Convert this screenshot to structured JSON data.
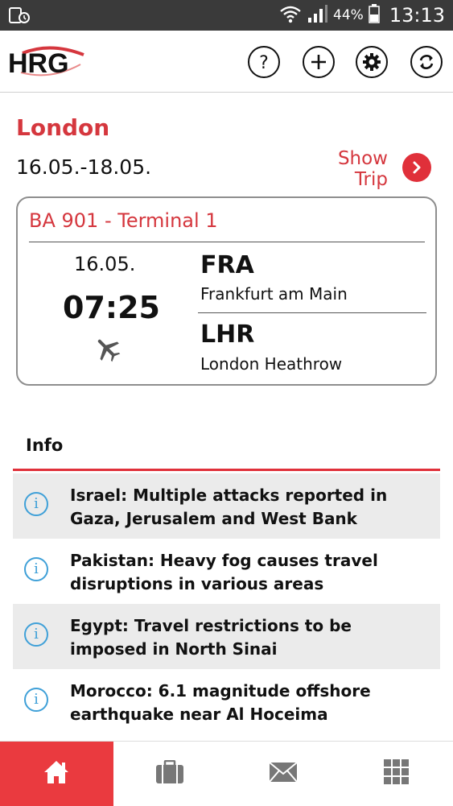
{
  "status_bar": {
    "battery_percent": "44%",
    "time": "13:13"
  },
  "header": {
    "logo_text": "HRG",
    "buttons": [
      {
        "icon": "help-icon"
      },
      {
        "icon": "add-icon"
      },
      {
        "icon": "settings-icon"
      },
      {
        "icon": "refresh-icon"
      }
    ]
  },
  "trip": {
    "city": "London",
    "dates": "16.05.-18.05.",
    "show_trip_label": "Show\nTrip"
  },
  "flight": {
    "title": "BA 901 - Terminal 1",
    "date": "16.05.",
    "time": "07:25",
    "origin": {
      "code": "FRA",
      "name": "Frankfurt am Main"
    },
    "destination": {
      "code": "LHR",
      "name": "London Heathrow"
    }
  },
  "info": {
    "heading": "Info",
    "items": [
      {
        "text": "Israel: Multiple attacks reported in Gaza, Jerusalem and West Bank"
      },
      {
        "text": "Pakistan: Heavy fog causes travel disruptions in various areas"
      },
      {
        "text": "Egypt: Travel restrictions to be imposed in North Sinai"
      },
      {
        "text": "Morocco: 6.1 magnitude offshore earthquake near Al Hoceima"
      }
    ]
  },
  "bottom_nav": [
    {
      "icon": "home-icon",
      "active": true
    },
    {
      "icon": "briefcase-icon",
      "active": false
    },
    {
      "icon": "mail-icon",
      "active": false
    },
    {
      "icon": "grid-icon",
      "active": false
    }
  ],
  "colors": {
    "accent": "#d5373e",
    "nav_active": "#ea3a3f",
    "info_icon": "#3fa0d8"
  }
}
